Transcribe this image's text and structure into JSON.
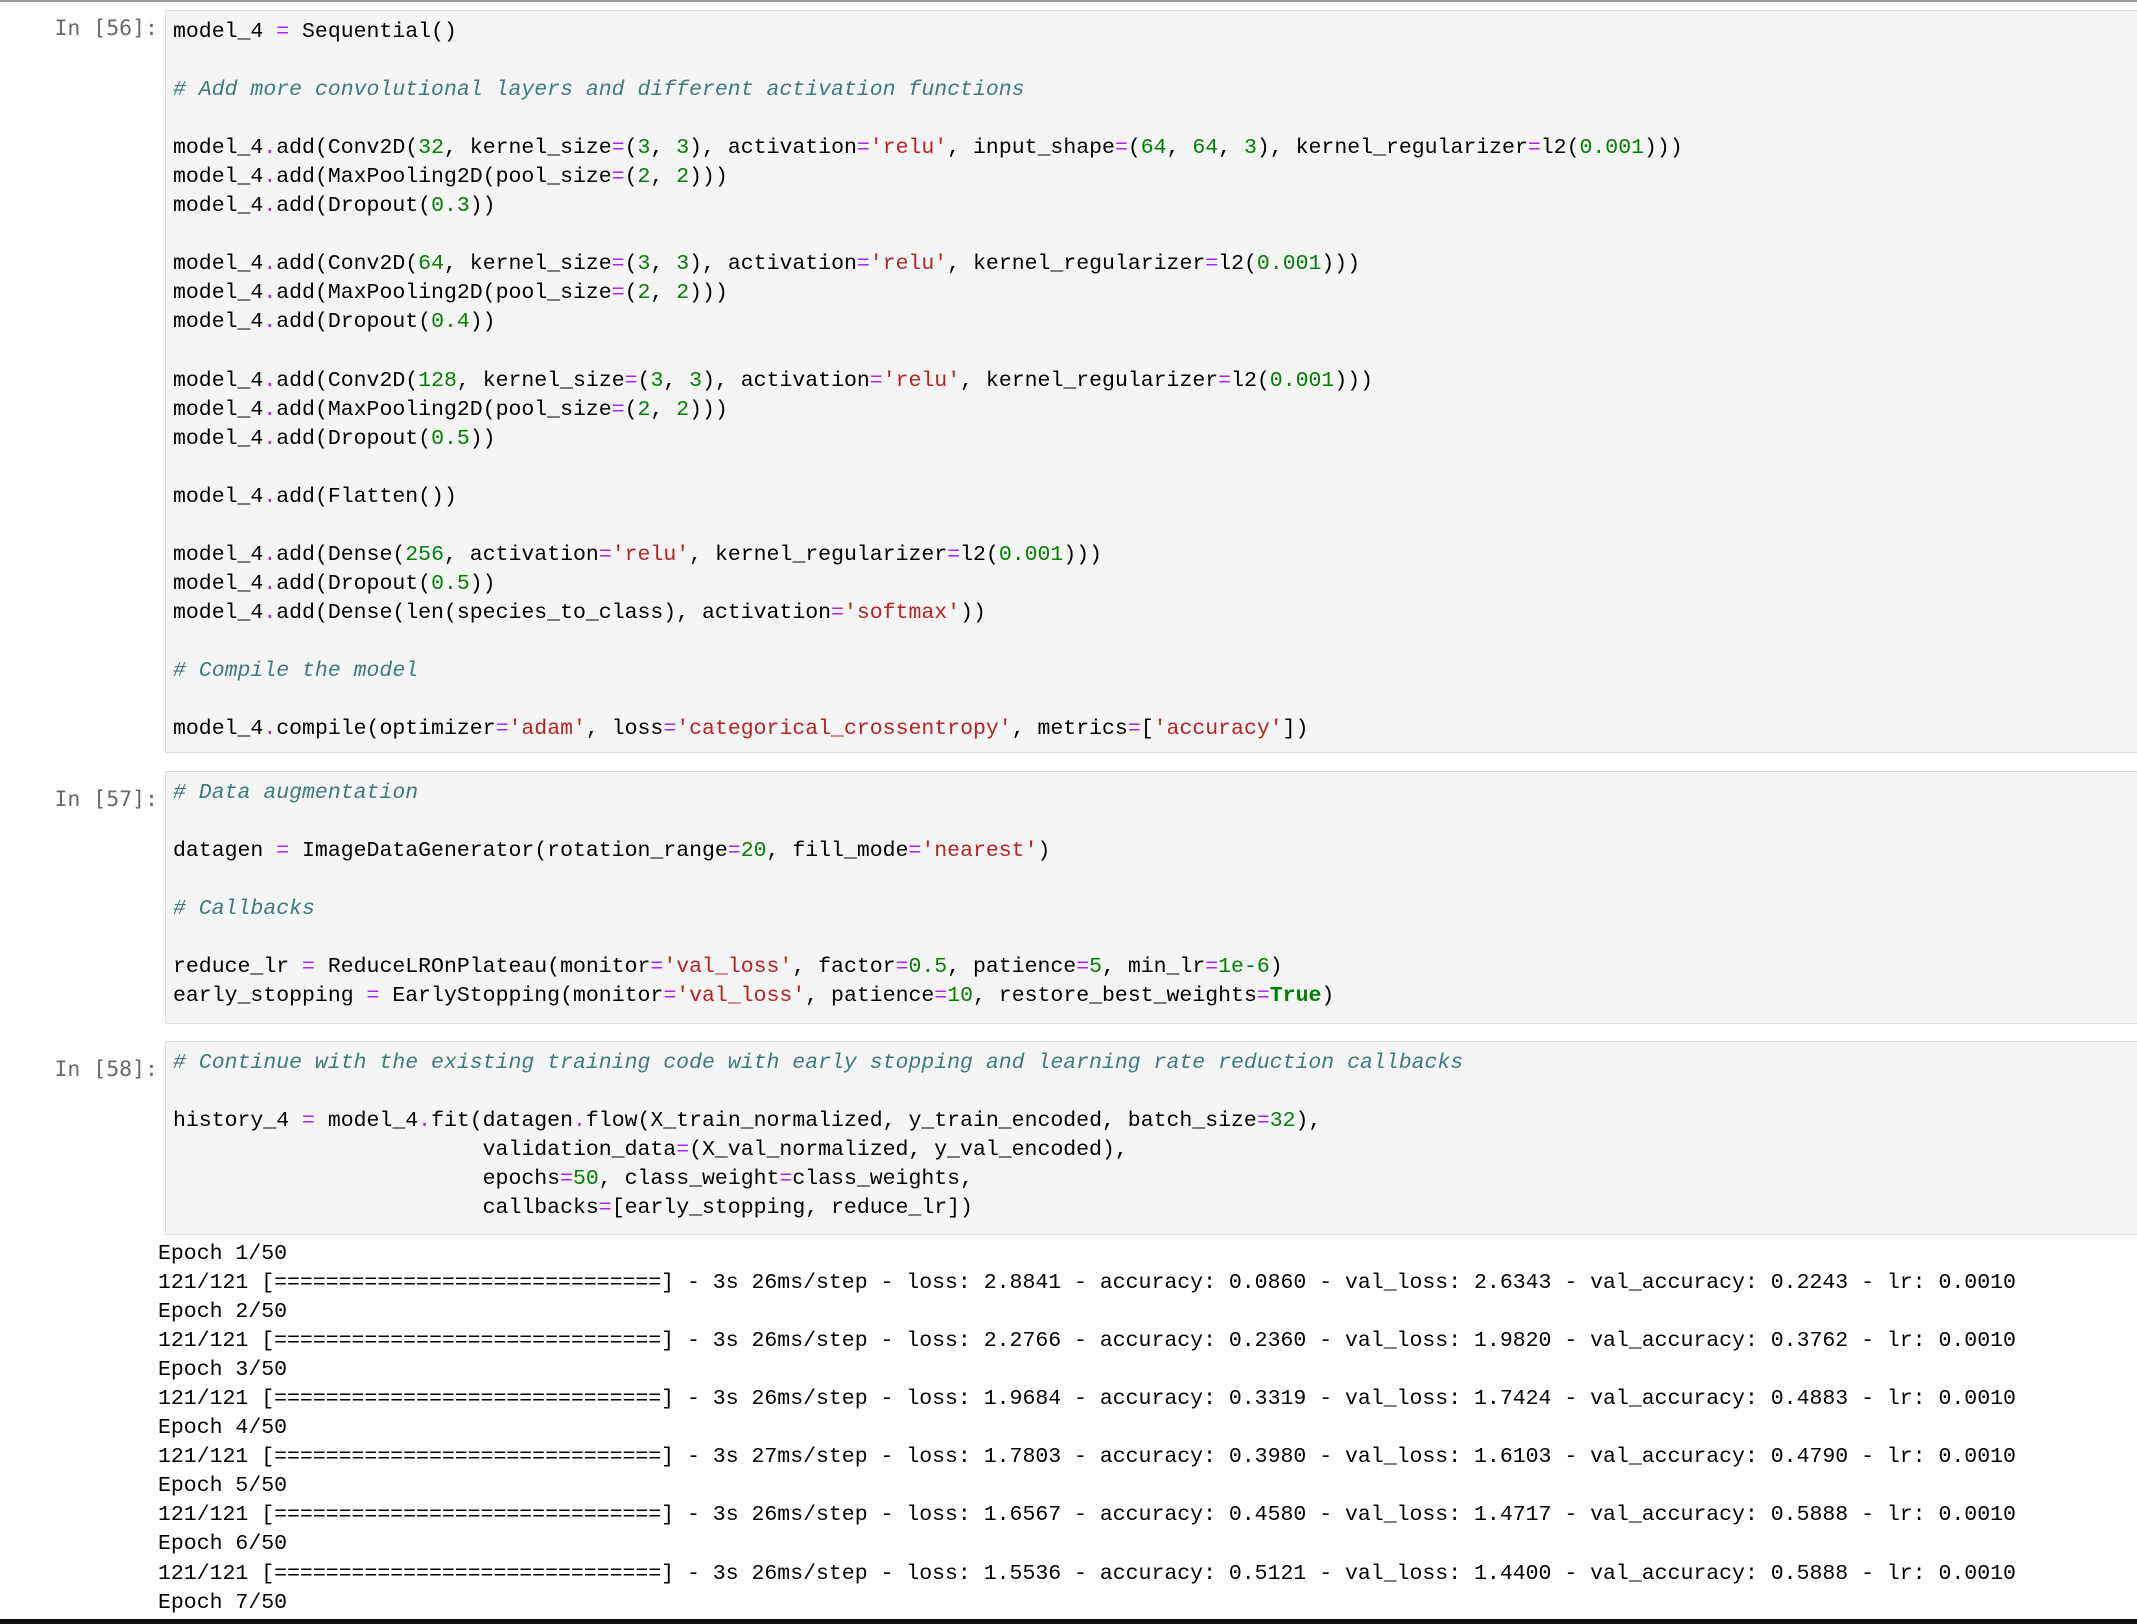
{
  "colors": {
    "comment": "#3d7b7b",
    "operator": "#aa22ff",
    "number": "#008000",
    "string": "#ba2121",
    "keyword": "#008000",
    "prompt": "#6a6a6a",
    "cell_background": "#f5f5f5"
  },
  "cells": [
    {
      "prompt": "In [56]:",
      "lines": [
        [
          [
            "p",
            "model_4 "
          ],
          [
            "o",
            "="
          ],
          [
            "p",
            " Sequential()"
          ]
        ],
        [],
        [
          [
            "c",
            "# Add more convolutional layers and different activation functions"
          ]
        ],
        [],
        [
          [
            "p",
            "model_4"
          ],
          [
            "o",
            "."
          ],
          [
            "p",
            "add(Conv2D("
          ],
          [
            "n",
            "32"
          ],
          [
            "p",
            ", kernel_size"
          ],
          [
            "o",
            "="
          ],
          [
            "p",
            "("
          ],
          [
            "n",
            "3"
          ],
          [
            "p",
            ", "
          ],
          [
            "n",
            "3"
          ],
          [
            "p",
            "), activation"
          ],
          [
            "o",
            "="
          ],
          [
            "s",
            "'relu'"
          ],
          [
            "p",
            ", input_shape"
          ],
          [
            "o",
            "="
          ],
          [
            "p",
            "("
          ],
          [
            "n",
            "64"
          ],
          [
            "p",
            ", "
          ],
          [
            "n",
            "64"
          ],
          [
            "p",
            ", "
          ],
          [
            "n",
            "3"
          ],
          [
            "p",
            "), kernel_regularizer"
          ],
          [
            "o",
            "="
          ],
          [
            "p",
            "l2("
          ],
          [
            "n",
            "0.001"
          ],
          [
            "p",
            ")))"
          ]
        ],
        [
          [
            "p",
            "model_4"
          ],
          [
            "o",
            "."
          ],
          [
            "p",
            "add(MaxPooling2D(pool_size"
          ],
          [
            "o",
            "="
          ],
          [
            "p",
            "("
          ],
          [
            "n",
            "2"
          ],
          [
            "p",
            ", "
          ],
          [
            "n",
            "2"
          ],
          [
            "p",
            ")))"
          ]
        ],
        [
          [
            "p",
            "model_4"
          ],
          [
            "o",
            "."
          ],
          [
            "p",
            "add(Dropout("
          ],
          [
            "n",
            "0.3"
          ],
          [
            "p",
            "))"
          ]
        ],
        [],
        [
          [
            "p",
            "model_4"
          ],
          [
            "o",
            "."
          ],
          [
            "p",
            "add(Conv2D("
          ],
          [
            "n",
            "64"
          ],
          [
            "p",
            ", kernel_size"
          ],
          [
            "o",
            "="
          ],
          [
            "p",
            "("
          ],
          [
            "n",
            "3"
          ],
          [
            "p",
            ", "
          ],
          [
            "n",
            "3"
          ],
          [
            "p",
            "), activation"
          ],
          [
            "o",
            "="
          ],
          [
            "s",
            "'relu'"
          ],
          [
            "p",
            ", kernel_regularizer"
          ],
          [
            "o",
            "="
          ],
          [
            "p",
            "l2("
          ],
          [
            "n",
            "0.001"
          ],
          [
            "p",
            ")))"
          ]
        ],
        [
          [
            "p",
            "model_4"
          ],
          [
            "o",
            "."
          ],
          [
            "p",
            "add(MaxPooling2D(pool_size"
          ],
          [
            "o",
            "="
          ],
          [
            "p",
            "("
          ],
          [
            "n",
            "2"
          ],
          [
            "p",
            ", "
          ],
          [
            "n",
            "2"
          ],
          [
            "p",
            ")))"
          ]
        ],
        [
          [
            "p",
            "model_4"
          ],
          [
            "o",
            "."
          ],
          [
            "p",
            "add(Dropout("
          ],
          [
            "n",
            "0.4"
          ],
          [
            "p",
            "))"
          ]
        ],
        [],
        [
          [
            "p",
            "model_4"
          ],
          [
            "o",
            "."
          ],
          [
            "p",
            "add(Conv2D("
          ],
          [
            "n",
            "128"
          ],
          [
            "p",
            ", kernel_size"
          ],
          [
            "o",
            "="
          ],
          [
            "p",
            "("
          ],
          [
            "n",
            "3"
          ],
          [
            "p",
            ", "
          ],
          [
            "n",
            "3"
          ],
          [
            "p",
            "), activation"
          ],
          [
            "o",
            "="
          ],
          [
            "s",
            "'relu'"
          ],
          [
            "p",
            ", kernel_regularizer"
          ],
          [
            "o",
            "="
          ],
          [
            "p",
            "l2("
          ],
          [
            "n",
            "0.001"
          ],
          [
            "p",
            ")))"
          ]
        ],
        [
          [
            "p",
            "model_4"
          ],
          [
            "o",
            "."
          ],
          [
            "p",
            "add(MaxPooling2D(pool_size"
          ],
          [
            "o",
            "="
          ],
          [
            "p",
            "("
          ],
          [
            "n",
            "2"
          ],
          [
            "p",
            ", "
          ],
          [
            "n",
            "2"
          ],
          [
            "p",
            ")))"
          ]
        ],
        [
          [
            "p",
            "model_4"
          ],
          [
            "o",
            "."
          ],
          [
            "p",
            "add(Dropout("
          ],
          [
            "n",
            "0.5"
          ],
          [
            "p",
            "))"
          ]
        ],
        [],
        [
          [
            "p",
            "model_4"
          ],
          [
            "o",
            "."
          ],
          [
            "p",
            "add(Flatten())"
          ]
        ],
        [],
        [
          [
            "p",
            "model_4"
          ],
          [
            "o",
            "."
          ],
          [
            "p",
            "add(Dense("
          ],
          [
            "n",
            "256"
          ],
          [
            "p",
            ", activation"
          ],
          [
            "o",
            "="
          ],
          [
            "s",
            "'relu'"
          ],
          [
            "p",
            ", kernel_regularizer"
          ],
          [
            "o",
            "="
          ],
          [
            "p",
            "l2("
          ],
          [
            "n",
            "0.001"
          ],
          [
            "p",
            ")))"
          ]
        ],
        [
          [
            "p",
            "model_4"
          ],
          [
            "o",
            "."
          ],
          [
            "p",
            "add(Dropout("
          ],
          [
            "n",
            "0.5"
          ],
          [
            "p",
            "))"
          ]
        ],
        [
          [
            "p",
            "model_4"
          ],
          [
            "o",
            "."
          ],
          [
            "p",
            "add(Dense(len(species_to_class), activation"
          ],
          [
            "o",
            "="
          ],
          [
            "s",
            "'softmax'"
          ],
          [
            "p",
            "))"
          ]
        ],
        [],
        [
          [
            "c",
            "# Compile the model"
          ]
        ],
        [],
        [
          [
            "p",
            "model_4"
          ],
          [
            "o",
            "."
          ],
          [
            "p",
            "compile(optimizer"
          ],
          [
            "o",
            "="
          ],
          [
            "s",
            "'adam'"
          ],
          [
            "p",
            ", loss"
          ],
          [
            "o",
            "="
          ],
          [
            "s",
            "'categorical_crossentropy'"
          ],
          [
            "p",
            ", metrics"
          ],
          [
            "o",
            "="
          ],
          [
            "p",
            "["
          ],
          [
            "s",
            "'accuracy'"
          ],
          [
            "p",
            "])"
          ]
        ]
      ]
    },
    {
      "prompt": "In [57]:",
      "lines": [
        [
          [
            "c",
            "# Data augmentation"
          ]
        ],
        [],
        [
          [
            "p",
            "datagen "
          ],
          [
            "o",
            "="
          ],
          [
            "p",
            " ImageDataGenerator(rotation_range"
          ],
          [
            "o",
            "="
          ],
          [
            "n",
            "20"
          ],
          [
            "p",
            ", fill_mode"
          ],
          [
            "o",
            "="
          ],
          [
            "s",
            "'nearest'"
          ],
          [
            "p",
            ")"
          ]
        ],
        [],
        [
          [
            "c",
            "# Callbacks"
          ]
        ],
        [],
        [
          [
            "p",
            "reduce_lr "
          ],
          [
            "o",
            "="
          ],
          [
            "p",
            " ReduceLROnPlateau(monitor"
          ],
          [
            "o",
            "="
          ],
          [
            "s",
            "'val_loss'"
          ],
          [
            "p",
            ", factor"
          ],
          [
            "o",
            "="
          ],
          [
            "n",
            "0.5"
          ],
          [
            "p",
            ", patience"
          ],
          [
            "o",
            "="
          ],
          [
            "n",
            "5"
          ],
          [
            "p",
            ", min_lr"
          ],
          [
            "o",
            "="
          ],
          [
            "n",
            "1e-6"
          ],
          [
            "p",
            ")"
          ]
        ],
        [
          [
            "p",
            "early_stopping "
          ],
          [
            "o",
            "="
          ],
          [
            "p",
            " EarlyStopping(monitor"
          ],
          [
            "o",
            "="
          ],
          [
            "s",
            "'val_loss'"
          ],
          [
            "p",
            ", patience"
          ],
          [
            "o",
            "="
          ],
          [
            "n",
            "10"
          ],
          [
            "p",
            ", restore_best_weights"
          ],
          [
            "o",
            "="
          ],
          [
            "k",
            "True"
          ],
          [
            "p",
            ")"
          ]
        ]
      ]
    },
    {
      "prompt": "In [58]:",
      "lines": [
        [
          [
            "c",
            "# Continue with the existing training code with early stopping and learning rate reduction callbacks"
          ]
        ],
        [],
        [
          [
            "p",
            "history_4 "
          ],
          [
            "o",
            "="
          ],
          [
            "p",
            " model_4"
          ],
          [
            "o",
            "."
          ],
          [
            "p",
            "fit(datagen"
          ],
          [
            "o",
            "."
          ],
          [
            "p",
            "flow(X_train_normalized, y_train_encoded, batch_size"
          ],
          [
            "o",
            "="
          ],
          [
            "n",
            "32"
          ],
          [
            "p",
            "),"
          ]
        ],
        [
          [
            "p",
            "                        validation_data"
          ],
          [
            "o",
            "="
          ],
          [
            "p",
            "(X_val_normalized, y_val_encoded),"
          ]
        ],
        [
          [
            "p",
            "                        epochs"
          ],
          [
            "o",
            "="
          ],
          [
            "n",
            "50"
          ],
          [
            "p",
            ", class_weight"
          ],
          [
            "o",
            "="
          ],
          [
            "p",
            "class_weights,"
          ]
        ],
        [
          [
            "p",
            "                        callbacks"
          ],
          [
            "o",
            "="
          ],
          [
            "p",
            "[early_stopping, reduce_lr])"
          ]
        ]
      ]
    }
  ],
  "output_lines": [
    "Epoch 1/50",
    "121/121 [==============================] - 3s 26ms/step - loss: 2.8841 - accuracy: 0.0860 - val_loss: 2.6343 - val_accuracy: 0.2243 - lr: 0.0010",
    "Epoch 2/50",
    "121/121 [==============================] - 3s 26ms/step - loss: 2.2766 - accuracy: 0.2360 - val_loss: 1.9820 - val_accuracy: 0.3762 - lr: 0.0010",
    "Epoch 3/50",
    "121/121 [==============================] - 3s 26ms/step - loss: 1.9684 - accuracy: 0.3319 - val_loss: 1.7424 - val_accuracy: 0.4883 - lr: 0.0010",
    "Epoch 4/50",
    "121/121 [==============================] - 3s 27ms/step - loss: 1.7803 - accuracy: 0.3980 - val_loss: 1.6103 - val_accuracy: 0.4790 - lr: 0.0010",
    "Epoch 5/50",
    "121/121 [==============================] - 3s 26ms/step - loss: 1.6567 - accuracy: 0.4580 - val_loss: 1.4717 - val_accuracy: 0.5888 - lr: 0.0010",
    "Epoch 6/50",
    "121/121 [==============================] - 3s 26ms/step - loss: 1.5536 - accuracy: 0.5121 - val_loss: 1.4400 - val_accuracy: 0.5888 - lr: 0.0010",
    "Epoch 7/50"
  ]
}
